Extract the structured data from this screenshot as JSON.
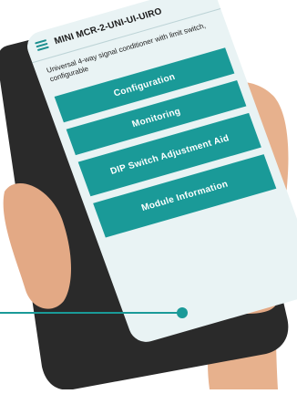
{
  "app": {
    "title": "MINI MCR-2-UNI-UI-UIRO",
    "description": "Universal 4-way signal conditioner with limit switch, configurable"
  },
  "menu": {
    "items": [
      {
        "label": "Configuration"
      },
      {
        "label": "Monitoring"
      },
      {
        "label": "DIP Switch Adjustment Aid"
      },
      {
        "label": "Module Information"
      }
    ]
  },
  "icons": {
    "menu": "hamburger-menu-icon",
    "camera": "front-camera-icon",
    "callout": "callout-dot-icon"
  },
  "colors": {
    "accent": "#1a9a98",
    "screen_bg": "#e9f3f4",
    "phone_frame": "#2a2a2a",
    "skin": "#e7b18d"
  }
}
